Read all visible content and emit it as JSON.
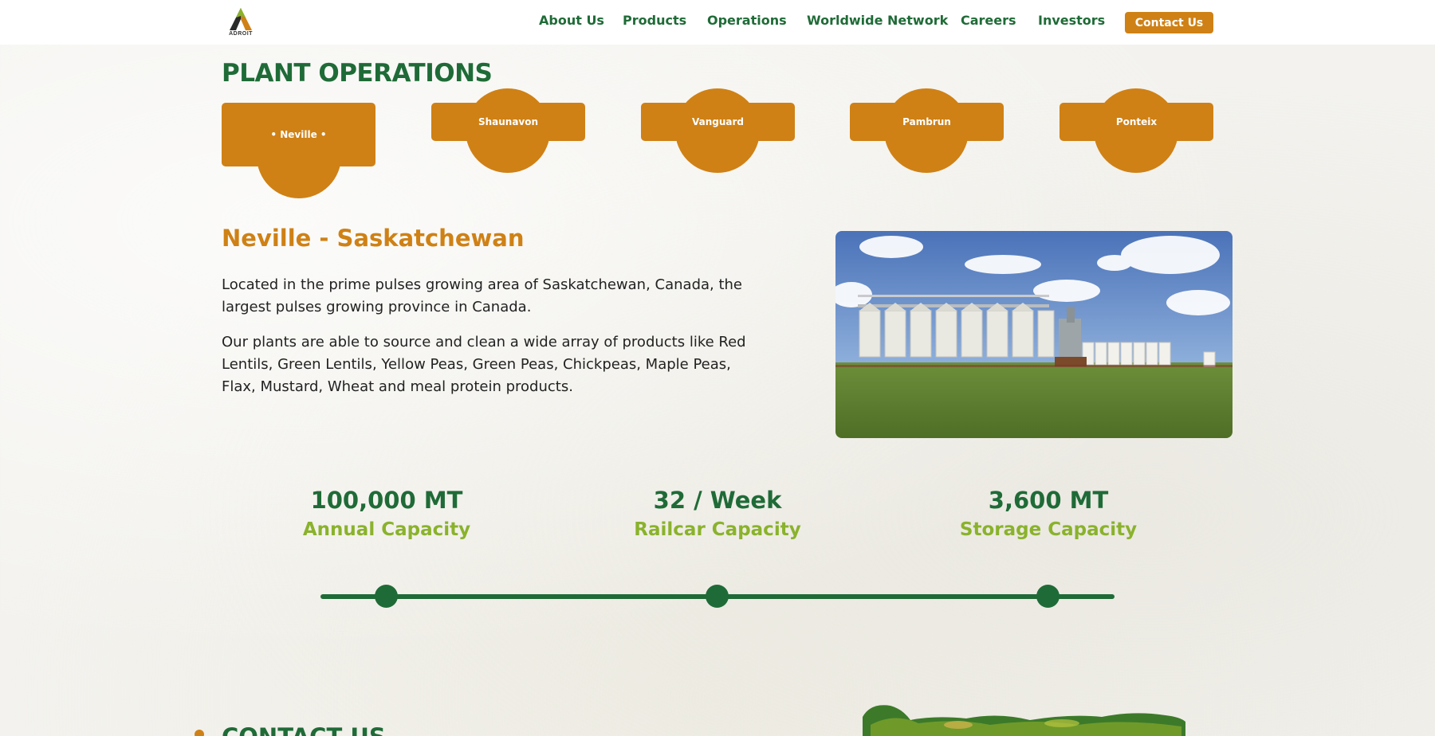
{
  "header": {
    "logo_text": "ADROIT",
    "nav": [
      "About Us",
      "Products",
      "Operations",
      "Worldwide Network",
      "Careers",
      "Investors"
    ],
    "contact_button": "Contact Us"
  },
  "section_title": "PLANT OPERATIONS",
  "tabs": [
    {
      "label": "• Neville •",
      "active": true
    },
    {
      "label": "Shaunavon",
      "active": false
    },
    {
      "label": "Vanguard",
      "active": false
    },
    {
      "label": "Pambrun",
      "active": false
    },
    {
      "label": "Ponteix",
      "active": false
    }
  ],
  "plant": {
    "title": "Neville - Saskatchewan",
    "paragraph_1": "Located in the prime pulses growing area of Saskatchewan, Canada, the largest pulses growing province in Canada.",
    "paragraph_2": "Our plants are able to source and clean a wide array of products like Red Lentils, Green Lentils, Yellow Peas, Green Peas, Chickpeas, Maple Peas, Flax, Mustard, Wheat and meal protein products."
  },
  "stats": [
    {
      "value": "100,000 MT",
      "label": "Annual Capacity"
    },
    {
      "value": "32 / Week",
      "label": "Railcar Capacity"
    },
    {
      "value": "3,600 MT",
      "label": "Storage Capacity"
    }
  ],
  "contact_heading": "CONTACT US",
  "colors": {
    "primary_green": "#1f6b37",
    "accent_orange": "#cf8115",
    "light_green": "#8ab22c"
  }
}
